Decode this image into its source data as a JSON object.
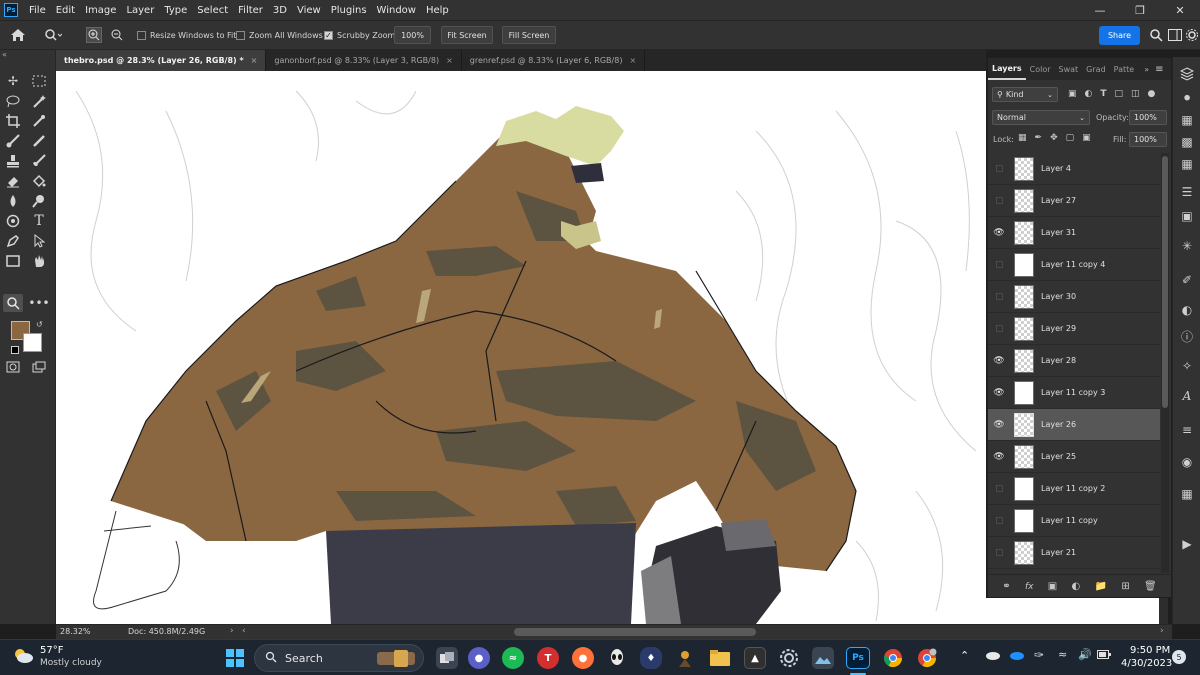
{
  "menu": {
    "logo": "Ps",
    "items": [
      "File",
      "Edit",
      "Image",
      "Layer",
      "Type",
      "Select",
      "Filter",
      "3D",
      "View",
      "Plugins",
      "Window",
      "Help"
    ]
  },
  "options": {
    "resize_windows": "Resize Windows to Fit",
    "zoom_all": "Zoom All Windows",
    "scrubby_zoom": "Scrubby Zoom",
    "zoom_value": "100%",
    "fit_screen": "Fit Screen",
    "fill_screen": "Fill Screen",
    "share": "Share"
  },
  "tabs": [
    {
      "label": "thebro.psd @ 28.3% (Layer 26, RGB/8) *",
      "close": "×"
    },
    {
      "label": "ganonborf.psd @ 8.33% (Layer 3, RGB/8)",
      "close": "×"
    },
    {
      "label": "grenref.psd @ 8.33% (Layer 6, RGB/8)",
      "close": "×"
    }
  ],
  "colors": {
    "foreground": "#8b6741",
    "background": "#ffffff",
    "skin": "#8b6741",
    "shadow": "#5b5241",
    "pants": "#3b3c47",
    "accent": "#1473e6"
  },
  "layers_panel": {
    "tabs": [
      "Layers",
      "Color",
      "Swat",
      "Grad",
      "Patte"
    ],
    "kind_label": "Kind",
    "blend_mode": "Normal",
    "opacity_label": "Opacity:",
    "opacity_value": "100%",
    "lock_label": "Lock:",
    "fill_label": "Fill:",
    "fill_value": "100%",
    "layers": [
      {
        "name": "Layer 4",
        "visible": false,
        "thumb": "checker",
        "active": false
      },
      {
        "name": "Layer 27",
        "visible": false,
        "thumb": "checker",
        "active": false
      },
      {
        "name": "Layer 31",
        "visible": true,
        "thumb": "checker",
        "active": false
      },
      {
        "name": "Layer 11 copy 4",
        "visible": false,
        "thumb": "white",
        "active": false
      },
      {
        "name": "Layer 30",
        "visible": false,
        "thumb": "checker",
        "active": false
      },
      {
        "name": "Layer 29",
        "visible": false,
        "thumb": "checker",
        "active": false
      },
      {
        "name": "Layer 28",
        "visible": true,
        "thumb": "checker",
        "active": false
      },
      {
        "name": "Layer 11 copy 3",
        "visible": true,
        "thumb": "white",
        "active": false
      },
      {
        "name": "Layer 26",
        "visible": true,
        "thumb": "checker",
        "active": true
      },
      {
        "name": "Layer 25",
        "visible": true,
        "thumb": "checker",
        "active": false
      },
      {
        "name": "Layer 11 copy 2",
        "visible": false,
        "thumb": "white",
        "active": false
      },
      {
        "name": "Layer 11 copy",
        "visible": false,
        "thumb": "white",
        "active": false
      },
      {
        "name": "Layer 21",
        "visible": false,
        "thumb": "checker",
        "active": false
      }
    ]
  },
  "status": {
    "zoom": "28.32%",
    "doc": "Doc: 450.8M/2.49G",
    "arrow": "›"
  },
  "taskbar": {
    "weather_temp": "57°F",
    "weather_desc": "Mostly cloudy",
    "search": "Search",
    "time": "9:50 PM",
    "date": "4/30/2023",
    "notification_count": "5"
  }
}
